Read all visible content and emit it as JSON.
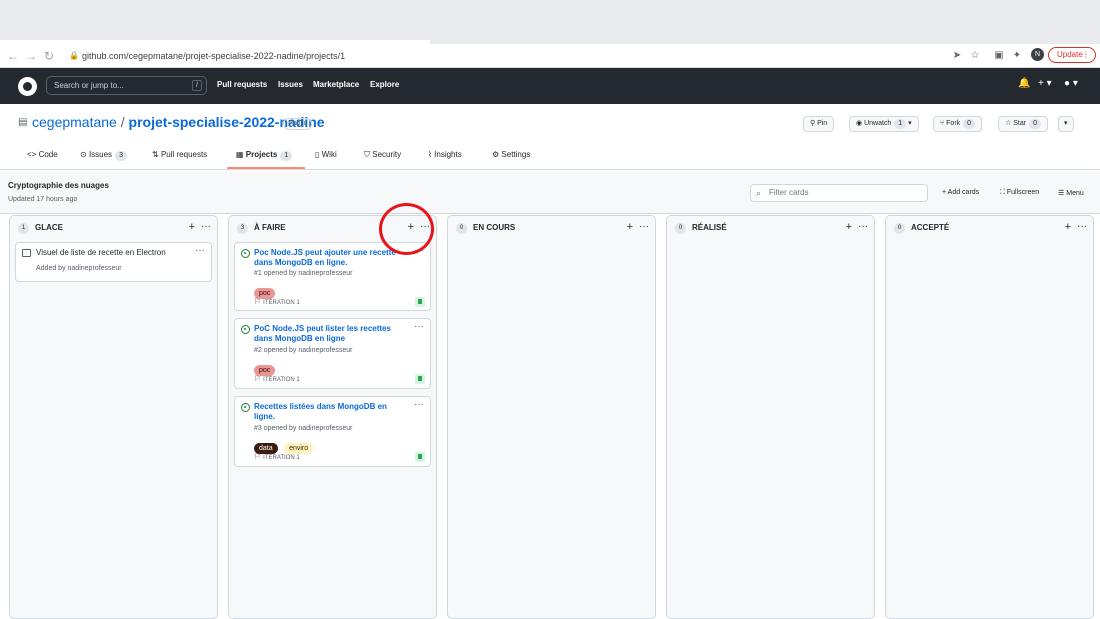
{
  "browser": {
    "url": "github.com/cegepmatane/projet-specialise-2022-nadine/projects/1",
    "profile_initial": "N",
    "update_label": "Update"
  },
  "gh_header": {
    "search_placeholder": "Search or jump to...",
    "search_hotkey": "/",
    "nav": [
      "Pull requests",
      "Issues",
      "Marketplace",
      "Explore"
    ]
  },
  "repo": {
    "owner": "cegepmatane",
    "separator": "/",
    "name": "projet-specialise-2022-nadine",
    "visibility": "Public",
    "pin_label": "Pin",
    "unwatch_label": "Unwatch",
    "unwatch_count": "1",
    "fork_label": "Fork",
    "fork_count": "0",
    "star_label": "Star",
    "star_count": "0"
  },
  "tabs": [
    {
      "label": "Code",
      "icon": "code-icon"
    },
    {
      "label": "Issues",
      "count": "3",
      "icon": "issue-opened-icon"
    },
    {
      "label": "Pull requests",
      "icon": "git-pull-request-icon"
    },
    {
      "label": "Projects",
      "count": "1",
      "icon": "project-icon",
      "selected": true
    },
    {
      "label": "Wiki",
      "icon": "book-icon"
    },
    {
      "label": "Security",
      "icon": "shield-icon"
    },
    {
      "label": "Insights",
      "icon": "graph-icon"
    },
    {
      "label": "Settings",
      "icon": "gear-icon"
    }
  ],
  "project": {
    "name": "Cryptographie des nuages",
    "updated": "Updated 17 hours ago",
    "filter_placeholder": "Filter cards",
    "add_cards": "Add cards",
    "fullscreen": "Fullscreen",
    "menu": "Menu"
  },
  "columns": [
    {
      "title": "GLACE",
      "count": "1",
      "note": {
        "text": "Visuel de liste de recette en Electron",
        "added_by": "Added by nadineprofesseur"
      }
    },
    {
      "title": "À FAIRE",
      "count": "3",
      "cards": [
        {
          "title": "Poc Node.JS peut ajouter une recette dans MongoDB en ligne.",
          "meta": "#1 opened by nadineprofesseur",
          "labels": [
            "poc"
          ],
          "milestone": "ITÉRATION 1"
        },
        {
          "title": "PoC Node.JS peut lister les recettes dans MongoDB en ligne",
          "meta": "#2 opened by nadineprofesseur",
          "labels": [
            "poc"
          ],
          "milestone": "ITÉRATION 1"
        },
        {
          "title": "Recettes listées dans MongoDB en ligne.",
          "meta": "#3 opened by nadineprofesseur",
          "labels": [
            "data",
            "enviro"
          ],
          "milestone": "ITÉRATION 1"
        }
      ]
    },
    {
      "title": "EN COURS",
      "count": "0"
    },
    {
      "title": "RÉALISÉ",
      "count": "0"
    },
    {
      "title": "ACCEPTÉ",
      "count": "0"
    }
  ],
  "colors": {
    "label_poc": "#e99695",
    "label_data": "#3b1c0e",
    "label_enviro": "#fef2c0",
    "highlight": "#e8141a",
    "selected_tab_underline": "#fd8c73"
  }
}
